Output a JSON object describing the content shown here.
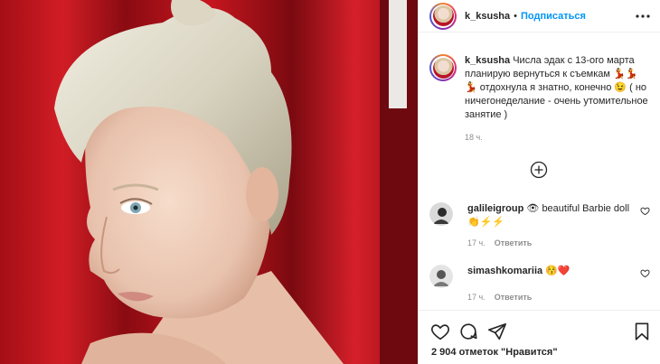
{
  "post": {
    "username": "k_ksusha",
    "follow_label": "Подписаться",
    "dot": "•"
  },
  "caption": {
    "username": "k_ksusha",
    "text_1": "Числа эдак с 13-ого марта планирую вернуться к съемкам",
    "text_2": "отдохнула я знатно, конечно",
    "text_3": "( но ничегонеделание - очень утомительное занятие )",
    "emoji_women": "💃💃",
    "emoji_woman2": "💃",
    "emoji_smile": "😉",
    "time": "18 ч."
  },
  "comments": [
    {
      "username": "galileigroup",
      "text": "beautiful Barbie doll",
      "emoji_eye": "👁",
      "emoji_bolts": "⚡⚡",
      "emoji_hand": "👏",
      "time": "17 ч.",
      "reply": "Ответить"
    },
    {
      "username": "simashkomariia",
      "emoji": "😚❤️",
      "time": "17 ч.",
      "reply": "Ответить"
    }
  ],
  "likes_text": "2 904 отметок \"Нравится\"",
  "colors": {
    "accent": "#0095f6",
    "backdrop_red": "#b8162a"
  },
  "icons": [
    "more-icon",
    "add-comment-icon",
    "heart-icon",
    "comment-icon",
    "share-icon",
    "bookmark-icon"
  ]
}
